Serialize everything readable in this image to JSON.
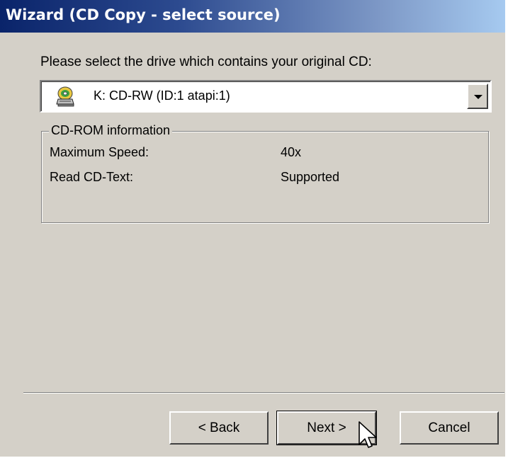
{
  "window": {
    "title": "Wizard (CD Copy - select source)"
  },
  "prompt_text": "Please select the drive which contains your original CD:",
  "drive_select": {
    "selected_value": "K: CD-RW (ID:1 atapi:1)",
    "icon": "cd-drive-icon"
  },
  "cdrom_info": {
    "legend": "CD-ROM information",
    "rows": [
      {
        "label": "Maximum Speed:",
        "value": "40x"
      },
      {
        "label": "Read CD-Text:",
        "value": "Supported"
      }
    ]
  },
  "buttons": {
    "back_label": "< Back",
    "next_label": "Next >",
    "cancel_label": "Cancel"
  },
  "colors": {
    "title_gradient_start": "#0a246a",
    "title_gradient_end": "#a6caf0",
    "dialog_face": "#d4d0c8"
  }
}
